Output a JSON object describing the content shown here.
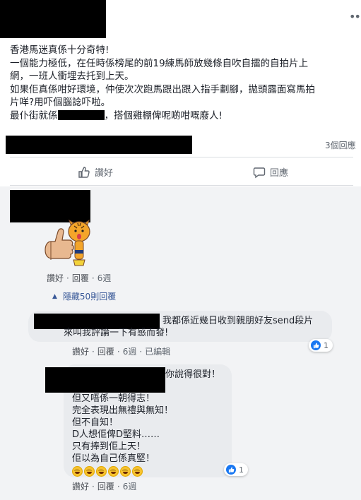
{
  "post": {
    "lines": [
      "香港馬迷真係十分奇特!",
      "一個能力極低，在任時係榜尾的前19練馬師放幾條自吹自擂的自拍片上",
      "網，一班人衝埋去托到上天。",
      "如果佢真係咁好環境，仲使次次跑馬跟出跟入指手劃腳，拋頭露面寫馬拍",
      "片咩?用吓個腦諗吓啦。"
    ],
    "last_line_prefix": "最仆街就係",
    "last_line_suffix": "，搭個雞棚俾呢啲咁嘅廢人!",
    "reply_count": "3個回應"
  },
  "actions": {
    "like": "讚好",
    "reply": "回應"
  },
  "comments": {
    "top": {
      "like": "讚好",
      "reply": "回覆",
      "time": "6週"
    },
    "hidden_replies": "隱藏50則回覆",
    "reply1": {
      "lines": [
        "我都係近幾日收到親朋好友send段片",
        "來叫我評論一下有感而發!"
      ],
      "reaction_count": "1",
      "like": "讚好",
      "reply": "回覆",
      "time": "6週",
      "edited": "已編輯"
    },
    "reply2": {
      "first_line": "你說得很對！",
      "lines": [
        "但又唔係一朝得志！",
        "完全表現出無禮與無知！",
        "但不自知！",
        "D人想佢俾D堅料……",
        "只有捧到佢上天！",
        "佢以為自己係真堅！"
      ],
      "reaction_count": "1",
      "like": "讚好",
      "reply": "回覆",
      "time": "6週"
    }
  },
  "colors": {
    "link": "#385898",
    "muted": "#606770",
    "bubble": "#e9ebee",
    "like_blue": "#1877f2"
  }
}
